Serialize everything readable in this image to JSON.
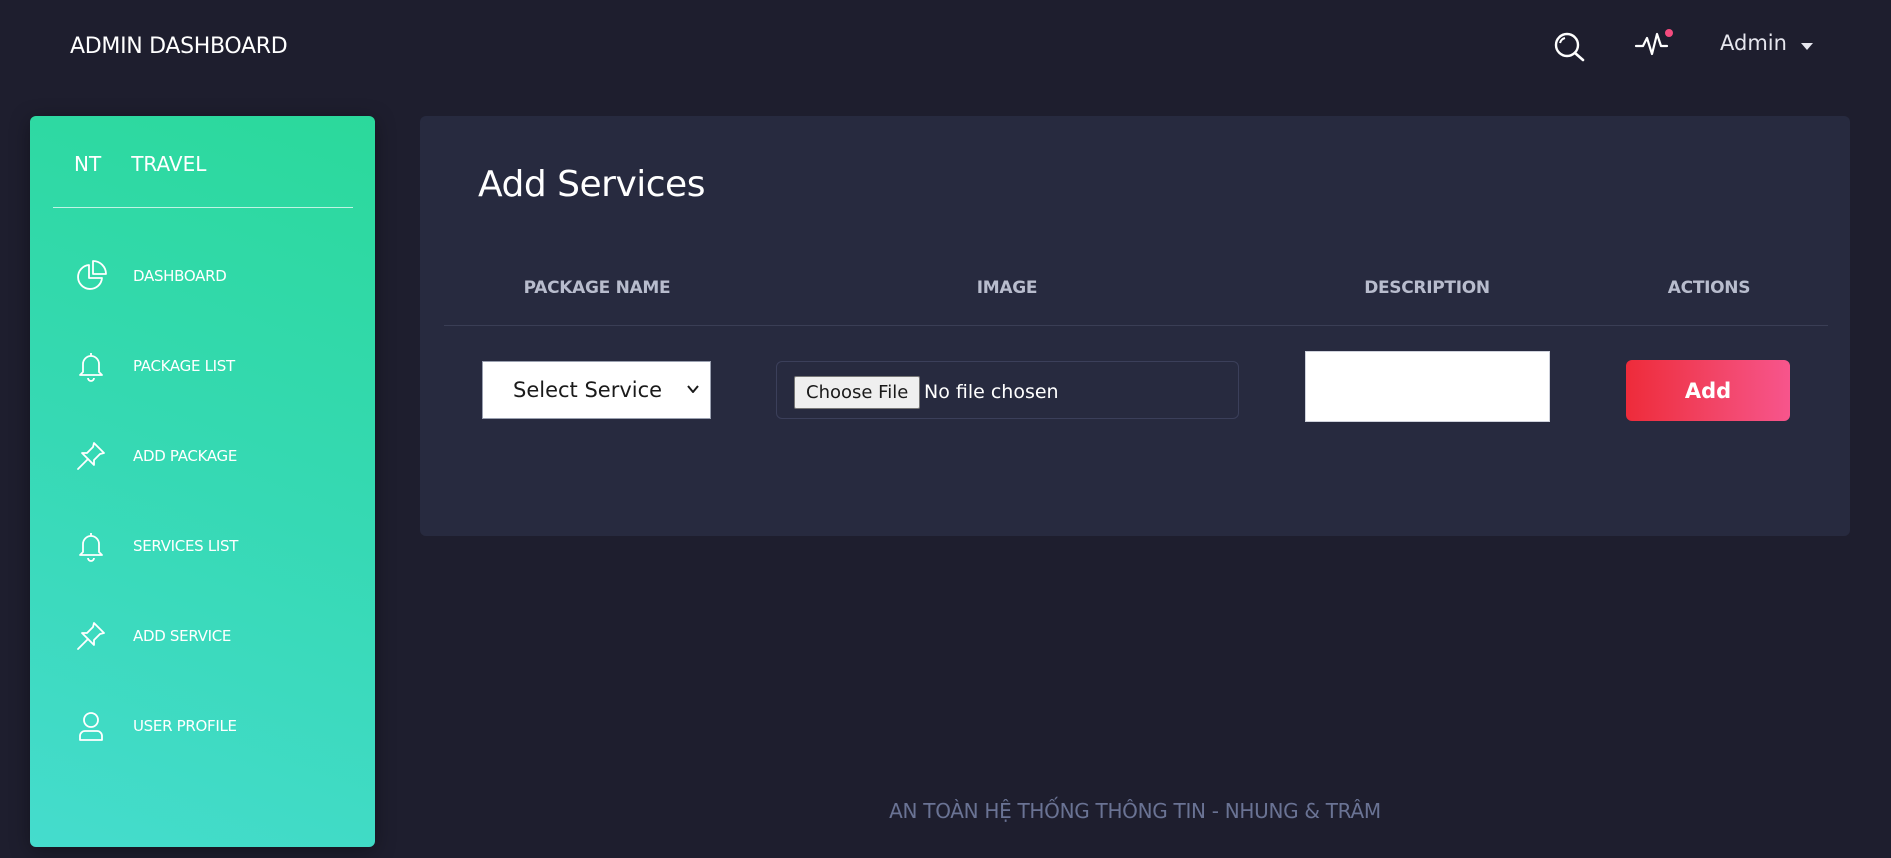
{
  "header": {
    "title": "ADMIN DASHBOARD",
    "user_label": "Admin",
    "notification_dot_color": "#f54b7e"
  },
  "sidebar": {
    "logo_left": "NT",
    "logo_right": "TRAVEL",
    "items": [
      {
        "label": "DASHBOARD",
        "icon": "pie-chart-icon"
      },
      {
        "label": "PACKAGE LIST",
        "icon": "bell-icon"
      },
      {
        "label": "ADD PACKAGE",
        "icon": "pin-icon"
      },
      {
        "label": "SERVICES LIST",
        "icon": "bell-icon"
      },
      {
        "label": "ADD SERVICE",
        "icon": "pin-icon"
      },
      {
        "label": "USER PROFILE",
        "icon": "user-icon"
      }
    ],
    "gradient_colors": [
      "#2bd99b",
      "#45dccd"
    ]
  },
  "main": {
    "title": "Add Services",
    "columns": [
      "PACKAGE NAME",
      "IMAGE",
      "DESCRIPTION",
      "ACTIONS"
    ],
    "form": {
      "service_select_value": "Select Service",
      "file_button_label": "Choose File",
      "file_status": "No file chosen",
      "description_value": "",
      "add_button_label": "Add"
    },
    "add_button_colors": [
      "#ee2b3a",
      "#f7558c"
    ]
  },
  "footer": {
    "text": "AN TOÀN HỆ THỐNG THÔNG TIN - NHUNG & TRÂM"
  }
}
